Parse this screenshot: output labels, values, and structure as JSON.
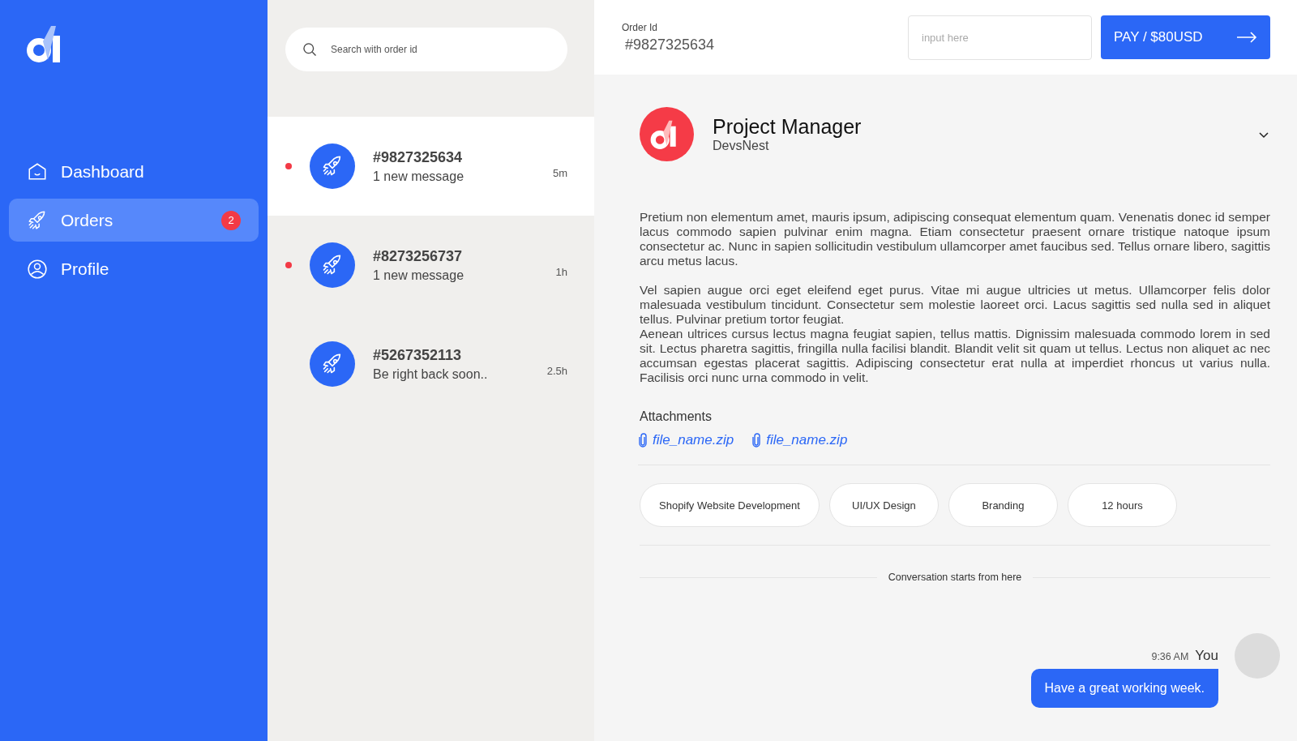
{
  "sidebar": {
    "items": [
      {
        "label": "Dashboard",
        "kind": "home",
        "selected": false
      },
      {
        "label": "Orders",
        "kind": "rocket",
        "selected": true,
        "badge": "2"
      },
      {
        "label": "Profile",
        "kind": "user",
        "selected": false
      }
    ]
  },
  "search": {
    "placeholder": "Search with order id"
  },
  "orders": [
    {
      "id": "#9827325634",
      "preview": "1 new message",
      "time": "5m",
      "unread": true,
      "selected": true
    },
    {
      "id": "#8273256737",
      "preview": "1 new message",
      "time": "1h",
      "unread": true,
      "selected": false
    },
    {
      "id": "#5267352113",
      "preview": "Be right back soon..",
      "time": "2.5h",
      "unread": false,
      "selected": false
    }
  ],
  "header": {
    "order_label": "Order Id",
    "order_id": "#9827325634",
    "input": {
      "placeholder": "input here"
    },
    "pay_button": "PAY / $80USD"
  },
  "contact": {
    "title": "Project Manager",
    "company": "DevsNest",
    "expanded": false
  },
  "paragraphs": [
    [
      "Pretium non elementum amet, mauris ipsum, adipiscing consequat elementum quam. Venenatis donec id semper lacus commodo sapien pulvinar enim magna. Etiam consectetur praesent ornare tristique natoque ipsum consectetur ac. Nunc in sapien sollicitudin vestibulum ullamcorper amet faucibus sed. Tellus ornare libero, sagittis arcu metus lacus."
    ],
    [
      "Vel sapien augue orci eget eleifend eget purus. Vitae mi augue ultricies ut metus. Ullamcorper felis dolor malesuada vestibulum tincidunt. Consectetur sem molestie laoreet orci. Lacus sagittis sed nulla sed in aliquet tellus. Pulvinar pretium tortor feugiat.",
      "Aenean ultrices cursus lectus magna feugiat sapien, tellus mattis. Dignissim malesuada commodo lorem in sed sit. Lectus pharetra sagittis, fringilla nulla facilisi blandit. Blandit velit sit quam ut tellus. Lectus non aliquet ac nec accumsan egestas placerat sagittis. Adipiscing consectetur erat nulla at imperdiet rhoncus ut varius nulla. Facilisis orci nunc urna commodo in velit."
    ]
  ],
  "attachments": {
    "title": "Attachments",
    "files": [
      "file_name.zip",
      "file_name.zip"
    ]
  },
  "tags": [
    "Shopify Website Development",
    "UI/UX Design",
    "Branding",
    "12 hours"
  ],
  "divider_text": "Conversation starts from here",
  "messages": [
    {
      "time": "9:36 AM",
      "sender": "You",
      "text": "Have a great working week."
    }
  ]
}
